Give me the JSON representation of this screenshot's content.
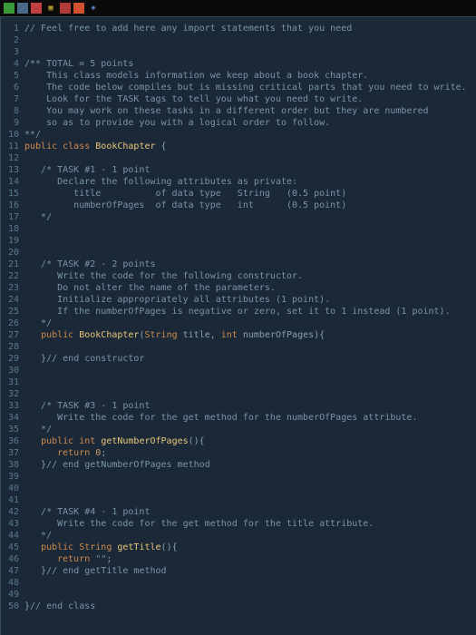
{
  "titlebar": {
    "icons": [
      "green-app",
      "window",
      "red-app",
      "clip",
      "red2",
      "pres",
      "browser"
    ]
  },
  "lines": [
    {
      "n": 1,
      "segs": [
        {
          "c": "c-comment",
          "t": "// Feel free to add here any import statements that you need"
        }
      ]
    },
    {
      "n": 2,
      "segs": []
    },
    {
      "n": 3,
      "segs": []
    },
    {
      "n": 4,
      "segs": [
        {
          "c": "c-comment",
          "t": "/** TOTAL = 5 points"
        }
      ]
    },
    {
      "n": 5,
      "segs": [
        {
          "c": "c-comment",
          "t": "    This class models information we keep about a book chapter."
        }
      ]
    },
    {
      "n": 6,
      "segs": [
        {
          "c": "c-comment",
          "t": "    The code below compiles but is missing critical parts that you need to write."
        }
      ]
    },
    {
      "n": 7,
      "segs": [
        {
          "c": "c-comment",
          "t": "    Look for the TASK tags to tell you what you need to write."
        }
      ]
    },
    {
      "n": 8,
      "segs": [
        {
          "c": "c-comment",
          "t": "    You may work on these tasks in a different order but they are numbered"
        }
      ]
    },
    {
      "n": 9,
      "segs": [
        {
          "c": "c-comment",
          "t": "    so as to provide you with a logical order to follow."
        }
      ]
    },
    {
      "n": 10,
      "segs": [
        {
          "c": "c-comment",
          "t": "**/"
        }
      ]
    },
    {
      "n": 11,
      "segs": [
        {
          "c": "c-keyword",
          "t": "public class "
        },
        {
          "c": "c-class",
          "t": "BookChapter"
        },
        {
          "c": "",
          "t": " {"
        }
      ]
    },
    {
      "n": 12,
      "segs": []
    },
    {
      "n": 13,
      "segs": [
        {
          "c": "c-comment",
          "t": "   /* TASK #1 - 1 point"
        }
      ]
    },
    {
      "n": 14,
      "segs": [
        {
          "c": "c-comment",
          "t": "      Declare the following attributes as private:"
        }
      ]
    },
    {
      "n": 15,
      "segs": [
        {
          "c": "c-comment",
          "t": "         title          of data type   String   (0.5 point)"
        }
      ]
    },
    {
      "n": 16,
      "segs": [
        {
          "c": "c-comment",
          "t": "         numberOfPages  of data type   int      (0.5 point)"
        }
      ]
    },
    {
      "n": 17,
      "segs": [
        {
          "c": "c-comment",
          "t": "   */"
        }
      ]
    },
    {
      "n": 18,
      "segs": []
    },
    {
      "n": 19,
      "segs": []
    },
    {
      "n": 20,
      "segs": []
    },
    {
      "n": 21,
      "segs": [
        {
          "c": "c-comment",
          "t": "   /* TASK #2 - 2 points"
        }
      ]
    },
    {
      "n": 22,
      "segs": [
        {
          "c": "c-comment",
          "t": "      Write the code for the following constructor."
        }
      ]
    },
    {
      "n": 23,
      "segs": [
        {
          "c": "c-comment",
          "t": "      Do not alter the name of the parameters."
        }
      ]
    },
    {
      "n": 24,
      "segs": [
        {
          "c": "c-comment",
          "t": "      Initialize appropriately all attributes (1 point)."
        }
      ]
    },
    {
      "n": 25,
      "segs": [
        {
          "c": "c-comment",
          "t": "      If the numberOfPages is negative or zero, set it to 1 instead (1 point)."
        }
      ]
    },
    {
      "n": 26,
      "segs": [
        {
          "c": "c-comment",
          "t": "   */"
        }
      ]
    },
    {
      "n": 27,
      "segs": [
        {
          "c": "",
          "t": "   "
        },
        {
          "c": "c-keyword",
          "t": "public "
        },
        {
          "c": "c-method",
          "t": "BookChapter"
        },
        {
          "c": "",
          "t": "("
        },
        {
          "c": "c-type",
          "t": "String"
        },
        {
          "c": "",
          "t": " title, "
        },
        {
          "c": "c-type",
          "t": "int"
        },
        {
          "c": "",
          "t": " numberOfPages){"
        }
      ]
    },
    {
      "n": 28,
      "segs": []
    },
    {
      "n": 29,
      "segs": [
        {
          "c": "",
          "t": "   }"
        },
        {
          "c": "c-comment",
          "t": "// end constructor"
        }
      ]
    },
    {
      "n": 30,
      "segs": []
    },
    {
      "n": 31,
      "segs": []
    },
    {
      "n": 32,
      "segs": []
    },
    {
      "n": 33,
      "segs": [
        {
          "c": "c-comment",
          "t": "   /* TASK #3 - 1 point"
        }
      ]
    },
    {
      "n": 34,
      "segs": [
        {
          "c": "c-comment",
          "t": "      Write the code for the get method for the numberOfPages attribute."
        }
      ]
    },
    {
      "n": 35,
      "segs": [
        {
          "c": "c-comment",
          "t": "   */"
        }
      ]
    },
    {
      "n": 36,
      "segs": [
        {
          "c": "",
          "t": "   "
        },
        {
          "c": "c-keyword",
          "t": "public "
        },
        {
          "c": "c-type",
          "t": "int "
        },
        {
          "c": "c-method",
          "t": "getNumberOfPages"
        },
        {
          "c": "",
          "t": "(){"
        }
      ]
    },
    {
      "n": 37,
      "segs": [
        {
          "c": "",
          "t": "      "
        },
        {
          "c": "c-keyword",
          "t": "return "
        },
        {
          "c": "c-number",
          "t": "0"
        },
        {
          "c": "",
          "t": ";"
        }
      ]
    },
    {
      "n": 38,
      "segs": [
        {
          "c": "",
          "t": "   }"
        },
        {
          "c": "c-comment",
          "t": "// end getNumberOfPages method"
        }
      ]
    },
    {
      "n": 39,
      "segs": []
    },
    {
      "n": 40,
      "segs": []
    },
    {
      "n": 41,
      "segs": []
    },
    {
      "n": 42,
      "segs": [
        {
          "c": "c-comment",
          "t": "   /* TASK #4 - 1 point"
        }
      ]
    },
    {
      "n": 43,
      "segs": [
        {
          "c": "c-comment",
          "t": "      Write the code for the get method for the title attribute."
        }
      ]
    },
    {
      "n": 44,
      "segs": [
        {
          "c": "c-comment",
          "t": "   */"
        }
      ]
    },
    {
      "n": 45,
      "segs": [
        {
          "c": "",
          "t": "   "
        },
        {
          "c": "c-keyword",
          "t": "public "
        },
        {
          "c": "c-type",
          "t": "String "
        },
        {
          "c": "c-method",
          "t": "getTitle"
        },
        {
          "c": "",
          "t": "(){"
        }
      ]
    },
    {
      "n": 46,
      "segs": [
        {
          "c": "",
          "t": "      "
        },
        {
          "c": "c-keyword",
          "t": "return "
        },
        {
          "c": "c-string",
          "t": "\"\""
        },
        {
          "c": "",
          "t": ";"
        }
      ]
    },
    {
      "n": 47,
      "segs": [
        {
          "c": "",
          "t": "   }"
        },
        {
          "c": "c-comment",
          "t": "// end getTitle method"
        }
      ]
    },
    {
      "n": 48,
      "segs": []
    },
    {
      "n": 49,
      "segs": []
    },
    {
      "n": 50,
      "segs": [
        {
          "c": "",
          "t": "}"
        },
        {
          "c": "c-comment",
          "t": "// end class"
        }
      ]
    }
  ]
}
